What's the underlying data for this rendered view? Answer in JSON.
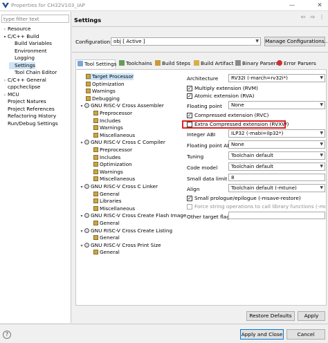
{
  "window": {
    "title": "Properties for CH32V103_IAP"
  },
  "left": {
    "filter_placeholder": "type filter text",
    "tree": [
      {
        "label": "Resource",
        "indent": 0,
        "twisty": ">"
      },
      {
        "label": "C/C++ Build",
        "indent": 0,
        "twisty": "v"
      },
      {
        "label": "Build Variables",
        "indent": 1,
        "twisty": ""
      },
      {
        "label": "Environment",
        "indent": 1,
        "twisty": ""
      },
      {
        "label": "Logging",
        "indent": 1,
        "twisty": ""
      },
      {
        "label": "Settings",
        "indent": 1,
        "twisty": "",
        "selected": true
      },
      {
        "label": "Tool Chain Editor",
        "indent": 1,
        "twisty": ""
      },
      {
        "label": "C/C++ General",
        "indent": 0,
        "twisty": ">"
      },
      {
        "label": "cppcheclipse",
        "indent": 0,
        "twisty": ""
      },
      {
        "label": "MCU",
        "indent": 0,
        "twisty": ">"
      },
      {
        "label": "Project Natures",
        "indent": 0,
        "twisty": ""
      },
      {
        "label": "Project References",
        "indent": 0,
        "twisty": ""
      },
      {
        "label": "Refactoring History",
        "indent": 0,
        "twisty": ""
      },
      {
        "label": "Run/Debug Settings",
        "indent": 0,
        "twisty": ""
      }
    ]
  },
  "settings": {
    "heading": "Settings",
    "configuration_label": "Configuration:",
    "configuration_value": "obj  [ Active ]",
    "manage_button": "Manage Configurations...",
    "tabs": [
      "Tool Settings",
      "Toolchains",
      "Build Steps",
      "Build Artifact",
      "Binary Parsers",
      "Error Parsers"
    ]
  },
  "tool_tree": [
    {
      "label": "Target Processor",
      "level": 1,
      "twisty": "",
      "selected": true
    },
    {
      "label": "Optimization",
      "level": 1,
      "twisty": ""
    },
    {
      "label": "Warnings",
      "level": 1,
      "twisty": ""
    },
    {
      "label": "Debugging",
      "level": 1,
      "twisty": ""
    },
    {
      "label": "GNU RISC-V Cross Assembler",
      "level": 0,
      "twisty": "v"
    },
    {
      "label": "Preprocessor",
      "level": 2,
      "twisty": ""
    },
    {
      "label": "Includes",
      "level": 2,
      "twisty": ""
    },
    {
      "label": "Warnings",
      "level": 2,
      "twisty": ""
    },
    {
      "label": "Miscellaneous",
      "level": 2,
      "twisty": ""
    },
    {
      "label": "GNU RISC-V Cross C Compiler",
      "level": 0,
      "twisty": "v"
    },
    {
      "label": "Preprocessor",
      "level": 2,
      "twisty": ""
    },
    {
      "label": "Includes",
      "level": 2,
      "twisty": ""
    },
    {
      "label": "Optimization",
      "level": 2,
      "twisty": ""
    },
    {
      "label": "Warnings",
      "level": 2,
      "twisty": ""
    },
    {
      "label": "Miscellaneous",
      "level": 2,
      "twisty": ""
    },
    {
      "label": "GNU RISC-V Cross C Linker",
      "level": 0,
      "twisty": "v"
    },
    {
      "label": "General",
      "level": 2,
      "twisty": ""
    },
    {
      "label": "Libraries",
      "level": 2,
      "twisty": ""
    },
    {
      "label": "Miscellaneous",
      "level": 2,
      "twisty": ""
    },
    {
      "label": "GNU RISC-V Cross Create Flash Image",
      "level": 0,
      "twisty": "v"
    },
    {
      "label": "General",
      "level": 2,
      "twisty": ""
    },
    {
      "label": "GNU RISC-V Cross Create Listing",
      "level": 0,
      "twisty": "v"
    },
    {
      "label": "General",
      "level": 2,
      "twisty": ""
    },
    {
      "label": "GNU RISC-V Cross Print Size",
      "level": 0,
      "twisty": "v"
    },
    {
      "label": "General",
      "level": 2,
      "twisty": ""
    }
  ],
  "options": {
    "architecture_label": "Architecture",
    "architecture_value": "RV32I (-march=rv32i*)",
    "mul_ext": "Multiply extension (RVM)",
    "mul_checked": "✓",
    "atomic_ext": "Atomic extension (RVA)",
    "atomic_checked": "✓",
    "float_label": "Floating point",
    "float_value": "None",
    "compressed_ext": "Compressed extension (RVC)",
    "compressed_checked": "✓",
    "extra_compressed_ext": "Extra Compressed extension (RVXW)",
    "int_abi_label": "Integer ABI",
    "int_abi_value": "ILP32 (-mabi=ilp32*)",
    "float_abi_label": "Floating point ABI",
    "float_abi_value": "None",
    "tuning_label": "Tuning",
    "tuning_value": "Toolchain default",
    "code_model_label": "Code model",
    "code_model_value": "Toolchain default",
    "small_data_label": "Small data limit",
    "small_data_value": "8",
    "align_label": "Align",
    "align_value": "Toolchain default (-mtune)",
    "small_prologue": "Small prologue/epilogue (-msave-restore)",
    "small_prologue_checked": "✓",
    "force_string": "Force string operations to call library functions (-mmemcp",
    "other_flags_label": "Other target flags"
  },
  "buttons": {
    "restore": "Restore Defaults",
    "apply": "Apply",
    "apply_close": "Apply and Close",
    "cancel": "Cancel"
  },
  "icons": {
    "help": "?",
    "minimize": "—",
    "close": "✕"
  }
}
